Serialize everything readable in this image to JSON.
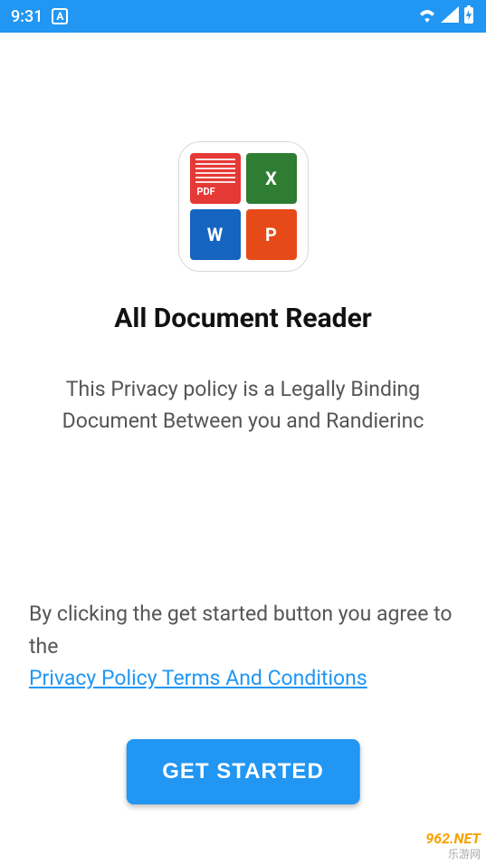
{
  "status_bar": {
    "time": "9:31",
    "left_icon_letter": "A"
  },
  "app": {
    "title": "All Document Reader",
    "subtitle": "This Privacy policy is a Legally Binding Document Between you and Randierinc",
    "icon_tiles": {
      "pdf": "PDF",
      "excel": "X",
      "word": "W",
      "ppt": "P"
    }
  },
  "agreement": {
    "text": "By clicking the get started button you agree to the",
    "link_text": "Privacy Policy Terms And Conditions"
  },
  "cta": {
    "label": "GET STARTED"
  },
  "watermark": {
    "site": "962.NET",
    "tag": "乐游网"
  }
}
